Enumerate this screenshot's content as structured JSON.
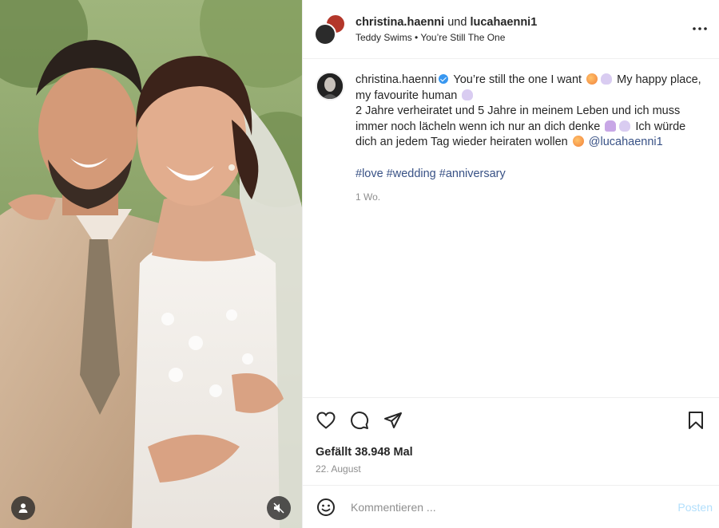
{
  "post": {
    "header": {
      "user1": "christina.haenni",
      "connector": "und",
      "user2": "lucahaenni1",
      "audio": "Teddy Swims • You’re Still The One",
      "more_icon": "more-horizontal-icon"
    },
    "caption": {
      "username": "christina.haenni",
      "verified": true,
      "line1": "You’re still the one I want",
      "line1b": "My happy place, my favourite human",
      "line2": "2 Jahre verheiratet und 5 Jahre in meinem Leben und ich muss immer noch lächeln wenn ich nur an dich denke",
      "line3": "Ich würde dich an jedem Tag wieder heiraten wollen",
      "mention": "@lucahaenni1",
      "hashtags": [
        "#love",
        "#wedding",
        "#anniversary"
      ],
      "time": "1 Wo."
    },
    "actions": {
      "like_icon": "heart-icon",
      "comment_icon": "comment-icon",
      "share_icon": "send-icon",
      "save_icon": "bookmark-icon",
      "likes": "Gefällt 38.948 Mal",
      "date": "22. August"
    },
    "comment": {
      "placeholder": "Kommentieren ...",
      "post_label": "Posten"
    }
  },
  "colors": {
    "link": "#385185",
    "muted": "#8e8e8e",
    "post_button": "#b2dffc",
    "verified": "#3897f0"
  }
}
